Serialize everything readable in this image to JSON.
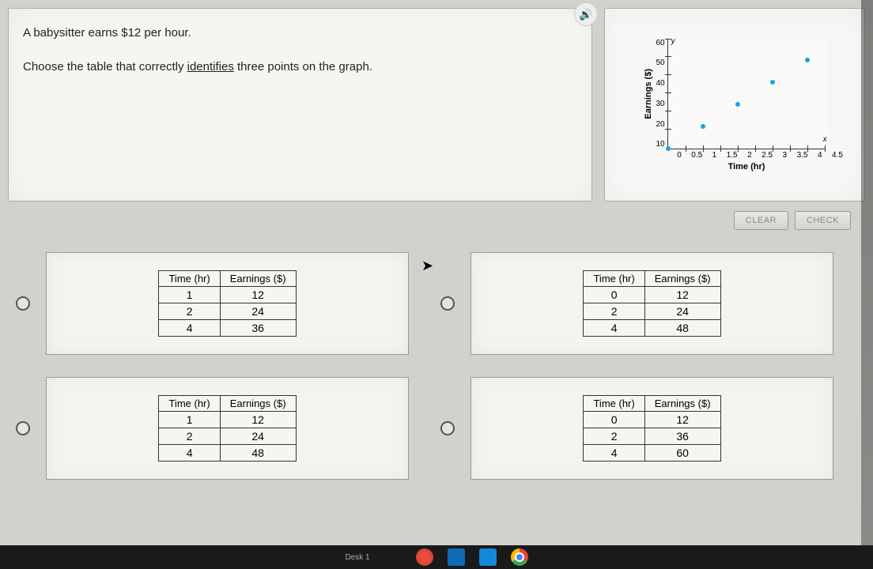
{
  "question": {
    "line1": "A babysitter earns $12 per hour.",
    "line2_pre": "Choose the table that correctly ",
    "identifies_word": "identifies",
    "line2_post": " three points on the graph."
  },
  "buttons": {
    "clear": "CLEAR",
    "check": "CHECK"
  },
  "chart_data": {
    "type": "scatter",
    "xlabel": "Time (hr)",
    "ylabel": "Earnings ($)",
    "y_axis_letter": "y",
    "x_axis_letter": "x",
    "xlim": [
      0,
      4.5
    ],
    "ylim": [
      0,
      60
    ],
    "x_ticks": [
      "0",
      "0.5",
      "1",
      "1.5",
      "2",
      "2.5",
      "3",
      "3.5",
      "4",
      "4.5"
    ],
    "y_ticks": [
      "60",
      "50",
      "40",
      "30",
      "20",
      "10"
    ],
    "points": [
      {
        "x": 0,
        "y": 0
      },
      {
        "x": 1,
        "y": 12
      },
      {
        "x": 2,
        "y": 24
      },
      {
        "x": 3,
        "y": 36
      },
      {
        "x": 4,
        "y": 48
      }
    ]
  },
  "table_headers": {
    "time": "Time (hr)",
    "earnings": "Earnings ($)"
  },
  "choices": [
    {
      "rows": [
        {
          "t": "1",
          "e": "12"
        },
        {
          "t": "2",
          "e": "24"
        },
        {
          "t": "4",
          "e": "36"
        }
      ]
    },
    {
      "rows": [
        {
          "t": "0",
          "e": "12"
        },
        {
          "t": "2",
          "e": "24"
        },
        {
          "t": "4",
          "e": "48"
        }
      ]
    },
    {
      "rows": [
        {
          "t": "1",
          "e": "12"
        },
        {
          "t": "2",
          "e": "24"
        },
        {
          "t": "4",
          "e": "48"
        }
      ]
    },
    {
      "rows": [
        {
          "t": "0",
          "e": "12"
        },
        {
          "t": "2",
          "e": "36"
        },
        {
          "t": "4",
          "e": "60"
        }
      ]
    }
  ],
  "taskbar": {
    "desk": "Desk 1"
  }
}
